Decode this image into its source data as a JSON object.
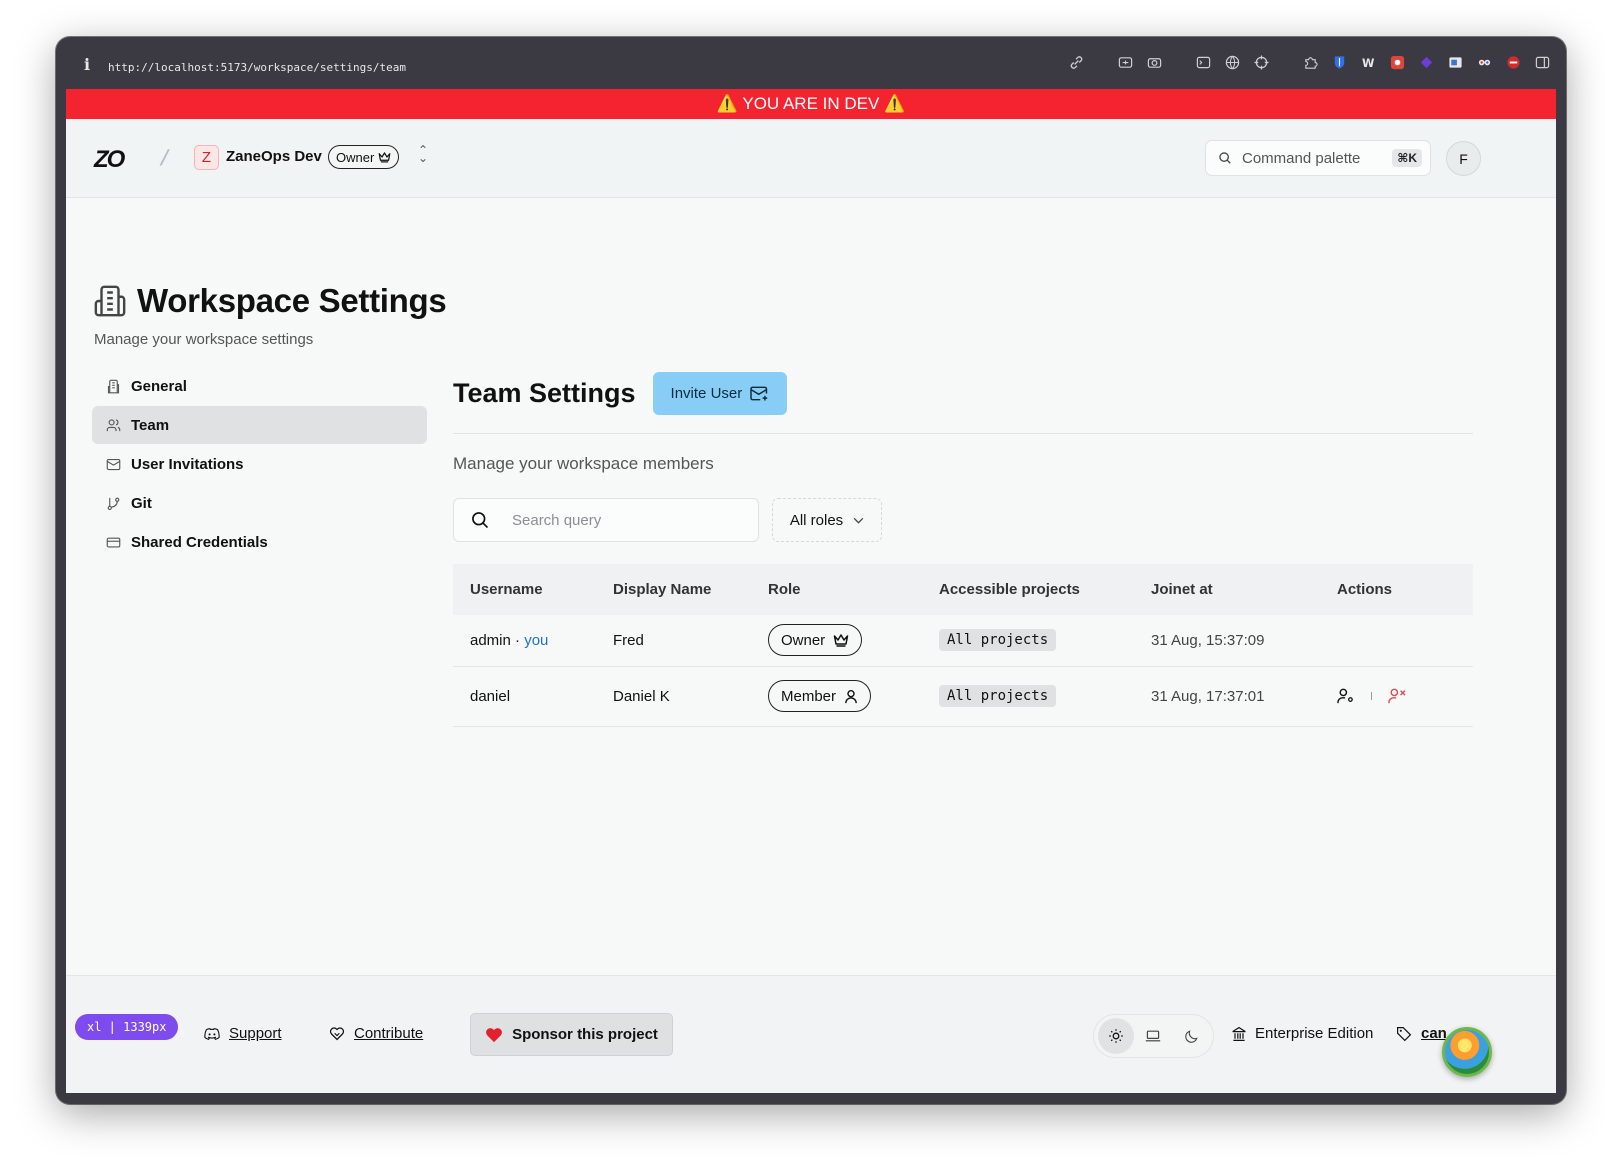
{
  "browser": {
    "url": "http://localhost:5173/workspace/settings/team",
    "info_glyph": "i"
  },
  "dev_banner": "⚠️ YOU ARE IN DEV ⚠️",
  "header": {
    "logo": "ZO",
    "workspace_initial": "Z",
    "workspace_name": "ZaneOps Dev",
    "workspace_role": "Owner",
    "command_palette": "Command palette",
    "command_shortcut": "⌘K",
    "user_initial": "F"
  },
  "page": {
    "title": "Workspace Settings",
    "subtitle": "Manage your workspace settings"
  },
  "sidebar": {
    "items": [
      {
        "label": "General",
        "icon": "building-icon",
        "active": false
      },
      {
        "label": "Team",
        "icon": "users-icon",
        "active": true
      },
      {
        "label": "User Invitations",
        "icon": "mail-icon",
        "active": false
      },
      {
        "label": "Git",
        "icon": "git-branch-icon",
        "active": false
      },
      {
        "label": "Shared Credentials",
        "icon": "credit-card-icon",
        "active": false
      }
    ]
  },
  "team": {
    "title": "Team Settings",
    "invite_label": "Invite User",
    "subtitle": "Manage your workspace members",
    "search_placeholder": "Search query",
    "role_filter": "All roles",
    "columns": [
      "Username",
      "Display Name",
      "Role",
      "Accessible projects",
      "Joinet at",
      "Actions"
    ],
    "rows": [
      {
        "username": "admin",
        "separator": " · ",
        "you": "you",
        "display_name": "Fred",
        "role": "Owner",
        "projects": "All projects",
        "joined": "31 Aug, 15:37:09",
        "has_actions": false
      },
      {
        "username": "daniel",
        "separator": "",
        "you": "",
        "display_name": "Daniel K",
        "role": "Member",
        "projects": "All projects",
        "joined": "31 Aug, 17:37:01",
        "has_actions": true
      }
    ]
  },
  "footer": {
    "breakpoint_badge": "xl  |  1339px",
    "support": "Support",
    "contribute": "Contribute",
    "sponsor": "Sponsor this project",
    "edition": "Enterprise Edition",
    "canary": "can"
  },
  "colors": {
    "dev_banner": "#f3232f",
    "invite_button": "#88cdf6",
    "you_link": "#1f6fd1",
    "remove_action": "#e5484d",
    "breakpoint_badge": "#7e4bef"
  }
}
